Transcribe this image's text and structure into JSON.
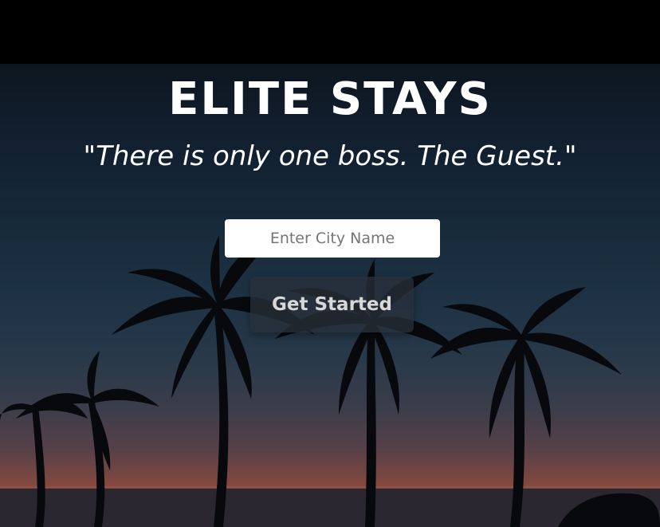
{
  "hero": {
    "title": "ELITE STAYS",
    "tagline": "\"There is only one boss. The Guest.\"",
    "background_scene": "palm-trees-sunset"
  },
  "search": {
    "placeholder": "Enter City Name",
    "value": ""
  },
  "cta": {
    "label": "Get Started"
  },
  "colors": {
    "sky_top": "#0d1620",
    "sky_horizon": "#8a4a3e",
    "title_text": "#ffffff",
    "button_bg": "#28303a"
  }
}
